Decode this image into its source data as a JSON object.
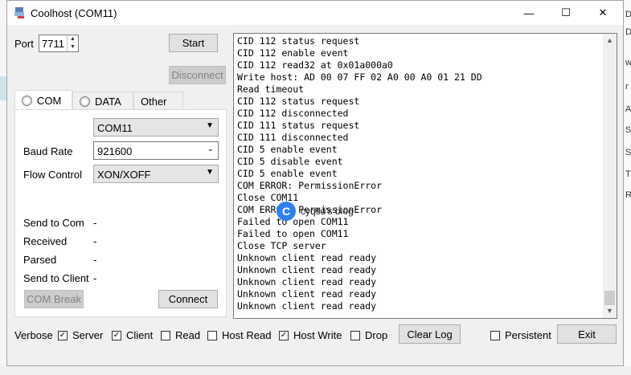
{
  "window": {
    "title": "Coolhost (COM11)",
    "minimize": "—",
    "maximize": "☐",
    "close": "✕"
  },
  "port": {
    "label": "Port",
    "value": "7711"
  },
  "buttons": {
    "start": "Start",
    "disconnect": "Disconnect",
    "com_break": "COM Break",
    "connect": "Connect",
    "clear_log": "Clear Log",
    "exit": "Exit"
  },
  "tabs": [
    {
      "label": "COM",
      "radio": true
    },
    {
      "label": "DATA",
      "radio": true
    },
    {
      "label": "Other",
      "radio": false
    }
  ],
  "com": {
    "port_value": "COM11",
    "baud_label": "Baud Rate",
    "baud_value": "921600",
    "flow_label": "Flow Control",
    "flow_value": "XON/XOFF"
  },
  "stats": [
    {
      "label": "Send to Com",
      "value": "-"
    },
    {
      "label": "Received",
      "value": "-"
    },
    {
      "label": "Parsed",
      "value": "-"
    },
    {
      "label": "Send to Client",
      "value": "-"
    }
  ],
  "log_lines": [
    "CID 112 status request",
    "CID 112 enable event",
    "CID 112 read32 at 0x01a000a0",
    "Write host: AD 00 07 FF 02 A0 00 A0 01 21 DD",
    "Read timeout",
    "CID 112 status request",
    "CID 112 disconnected",
    "CID 111 status request",
    "CID 111 disconnected",
    "CID 5 enable event",
    "CID 5 disable event",
    "CID 5 enable event",
    "COM ERROR: PermissionError",
    "Close COM11",
    "COM ERROR: PermissionError",
    "Failed to open COM11",
    "Failed to open COM11",
    "Close TCP server",
    "Unknown client read ready",
    "Unknown client read ready",
    "Unknown client read ready",
    "Unknown client read ready",
    "Unknown client read ready"
  ],
  "watermark": "cyqsd's blog",
  "verbose": {
    "label": "Verbose",
    "options": [
      {
        "label": "Server",
        "checked": true
      },
      {
        "label": "Client",
        "checked": true
      },
      {
        "label": "Read",
        "checked": false
      },
      {
        "label": "Host Read",
        "checked": false
      },
      {
        "label": "Host Write",
        "checked": true
      },
      {
        "label": "Drop",
        "checked": false
      }
    ]
  },
  "persistent": {
    "label": "Persistent",
    "checked": false
  },
  "background_letters": [
    "D",
    "Di",
    "w",
    "r",
    "A",
    "S",
    "S",
    "T",
    "R"
  ]
}
